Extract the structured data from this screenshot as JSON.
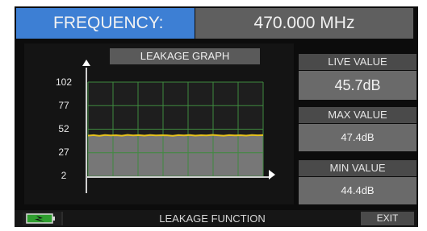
{
  "header": {
    "label": "FREQUENCY:",
    "value": "470.000 MHz"
  },
  "graph": {
    "title": "LEAKAGE GRAPH",
    "y_ticks": [
      "102",
      "77",
      "52",
      "27",
      "2"
    ],
    "trace_color": "#e6c21c",
    "grid_color": "#3f8a3f",
    "upper_fill": "#1e1e1e",
    "lower_fill": "#777777"
  },
  "chart_data": {
    "type": "line",
    "title": "LEAKAGE GRAPH",
    "xlabel": "",
    "ylabel": "",
    "yticks": [
      2,
      27,
      52,
      77,
      102
    ],
    "ylim": [
      2,
      102
    ],
    "grid": true,
    "series": [
      {
        "values": [
          45.2,
          45.7,
          45.0,
          45.8,
          45.3,
          45.6,
          45.1,
          45.9,
          45.4,
          45.7,
          45.2,
          45.8,
          45.3,
          45.6,
          45.5,
          45.0,
          45.7,
          45.4,
          45.8,
          45.2,
          45.6,
          45.3,
          45.9,
          45.5,
          45.1,
          45.7,
          45.4,
          45.6,
          45.2,
          45.8,
          45.5,
          45.7
        ]
      }
    ]
  },
  "side": {
    "live": {
      "label": "LIVE VALUE",
      "value": "45.7dB"
    },
    "max": {
      "label": "MAX VALUE",
      "value": "47.4dB"
    },
    "min": {
      "label": "MIN VALUE",
      "value": "44.4dB"
    }
  },
  "footer": {
    "function_label": "LEAKAGE FUNCTION",
    "exit_label": "EXIT"
  }
}
